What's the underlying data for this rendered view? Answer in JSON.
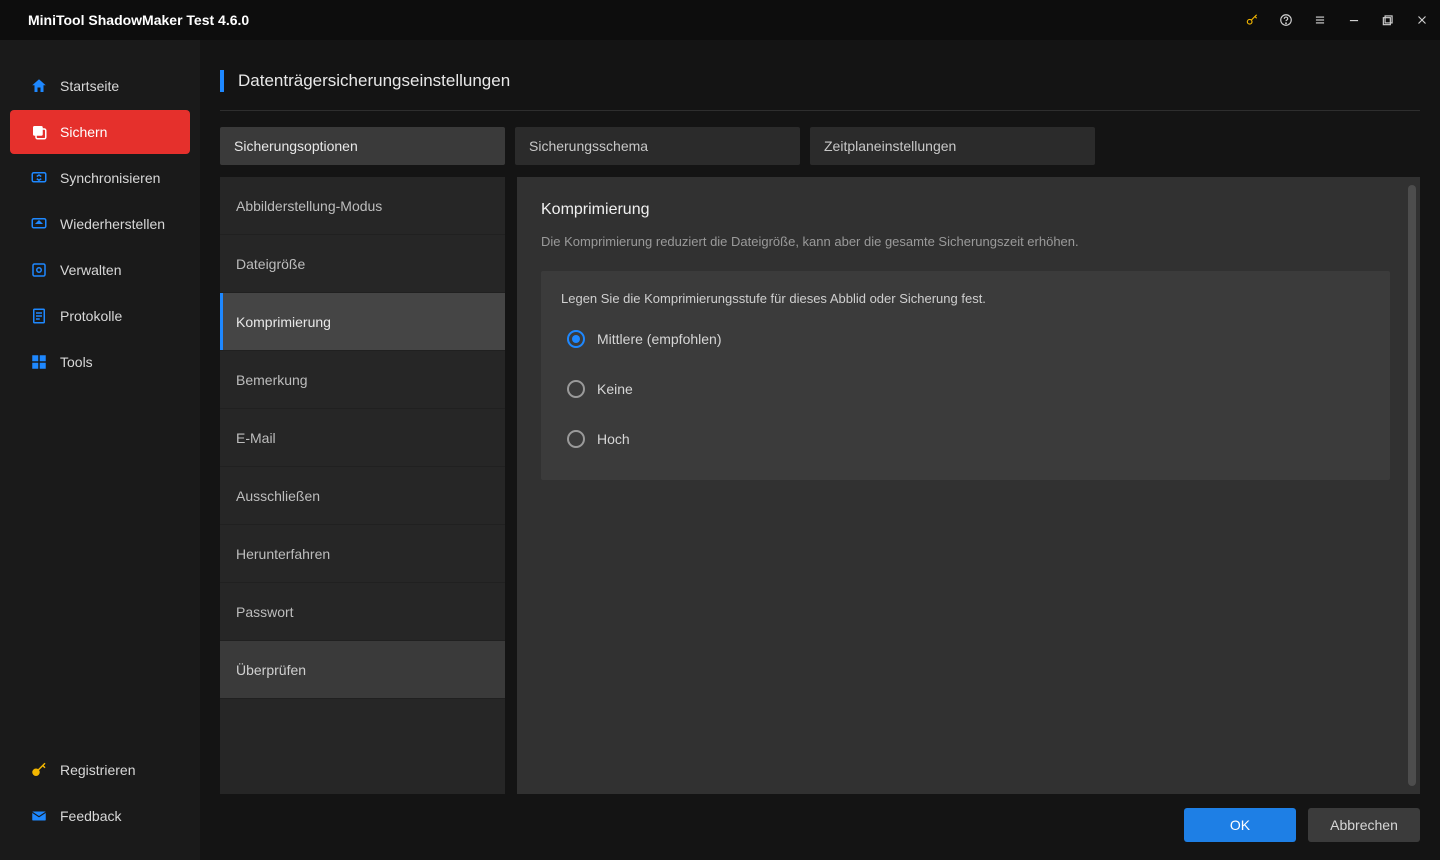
{
  "app_title": "MiniTool ShadowMaker Test 4.6.0",
  "sidebar": {
    "items": [
      {
        "label": "Startseite"
      },
      {
        "label": "Sichern"
      },
      {
        "label": "Synchronisieren"
      },
      {
        "label": "Wiederherstellen"
      },
      {
        "label": "Verwalten"
      },
      {
        "label": "Protokolle"
      },
      {
        "label": "Tools"
      }
    ],
    "bottom": [
      {
        "label": "Registrieren"
      },
      {
        "label": "Feedback"
      }
    ]
  },
  "page": {
    "title": "Datenträgersicherungseinstellungen",
    "tabs": [
      {
        "label": "Sicherungsoptionen"
      },
      {
        "label": "Sicherungsschema"
      },
      {
        "label": "Zeitplaneinstellungen"
      }
    ],
    "sublist": [
      {
        "label": "Abbilderstellung-Modus"
      },
      {
        "label": "Dateigröße"
      },
      {
        "label": "Komprimierung"
      },
      {
        "label": "Bemerkung"
      },
      {
        "label": "E-Mail"
      },
      {
        "label": "Ausschließen"
      },
      {
        "label": "Herunterfahren"
      },
      {
        "label": "Passwort"
      },
      {
        "label": "Überprüfen"
      }
    ],
    "detail": {
      "title": "Komprimierung",
      "desc": "Die Komprimierung reduziert die Dateigröße, kann aber die gesamte Sicherungszeit erhöhen.",
      "option_caption": "Legen Sie die Komprimierungsstufe für dieses Abblid oder Sicherung fest.",
      "radios": [
        {
          "label": "Mittlere (empfohlen)"
        },
        {
          "label": "Keine"
        },
        {
          "label": "Hoch"
        }
      ]
    },
    "footer": {
      "ok": "OK",
      "cancel": "Abbrechen"
    }
  }
}
